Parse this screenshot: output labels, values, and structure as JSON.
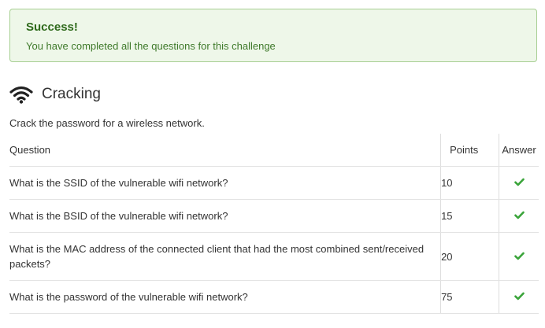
{
  "alert": {
    "title": "Success!",
    "message": "You have completed all the questions for this challenge"
  },
  "section": {
    "icon": "wifi-icon",
    "title": "Cracking",
    "description": "Crack the password for a wireless network."
  },
  "table": {
    "headers": {
      "question": "Question",
      "points": "Points",
      "answer": "Answer"
    },
    "rows": [
      {
        "question": "What is the SSID of the vulnerable wifi network?",
        "points": "10",
        "answer_icon": "check-icon"
      },
      {
        "question": "What is the BSID of the vulnerable wifi network?",
        "points": "15",
        "answer_icon": "check-icon"
      },
      {
        "question": "What is the MAC address of the connected client that had the most combined sent/received packets?",
        "points": "20",
        "answer_icon": "check-icon"
      },
      {
        "question": "What is the password of the vulnerable wifi network?",
        "points": "75",
        "answer_icon": "check-icon"
      }
    ]
  },
  "colors": {
    "success_bg": "#eef7e9",
    "success_border": "#a7cf92",
    "success_text": "#2f6a1c",
    "check": "#3aa43a"
  }
}
